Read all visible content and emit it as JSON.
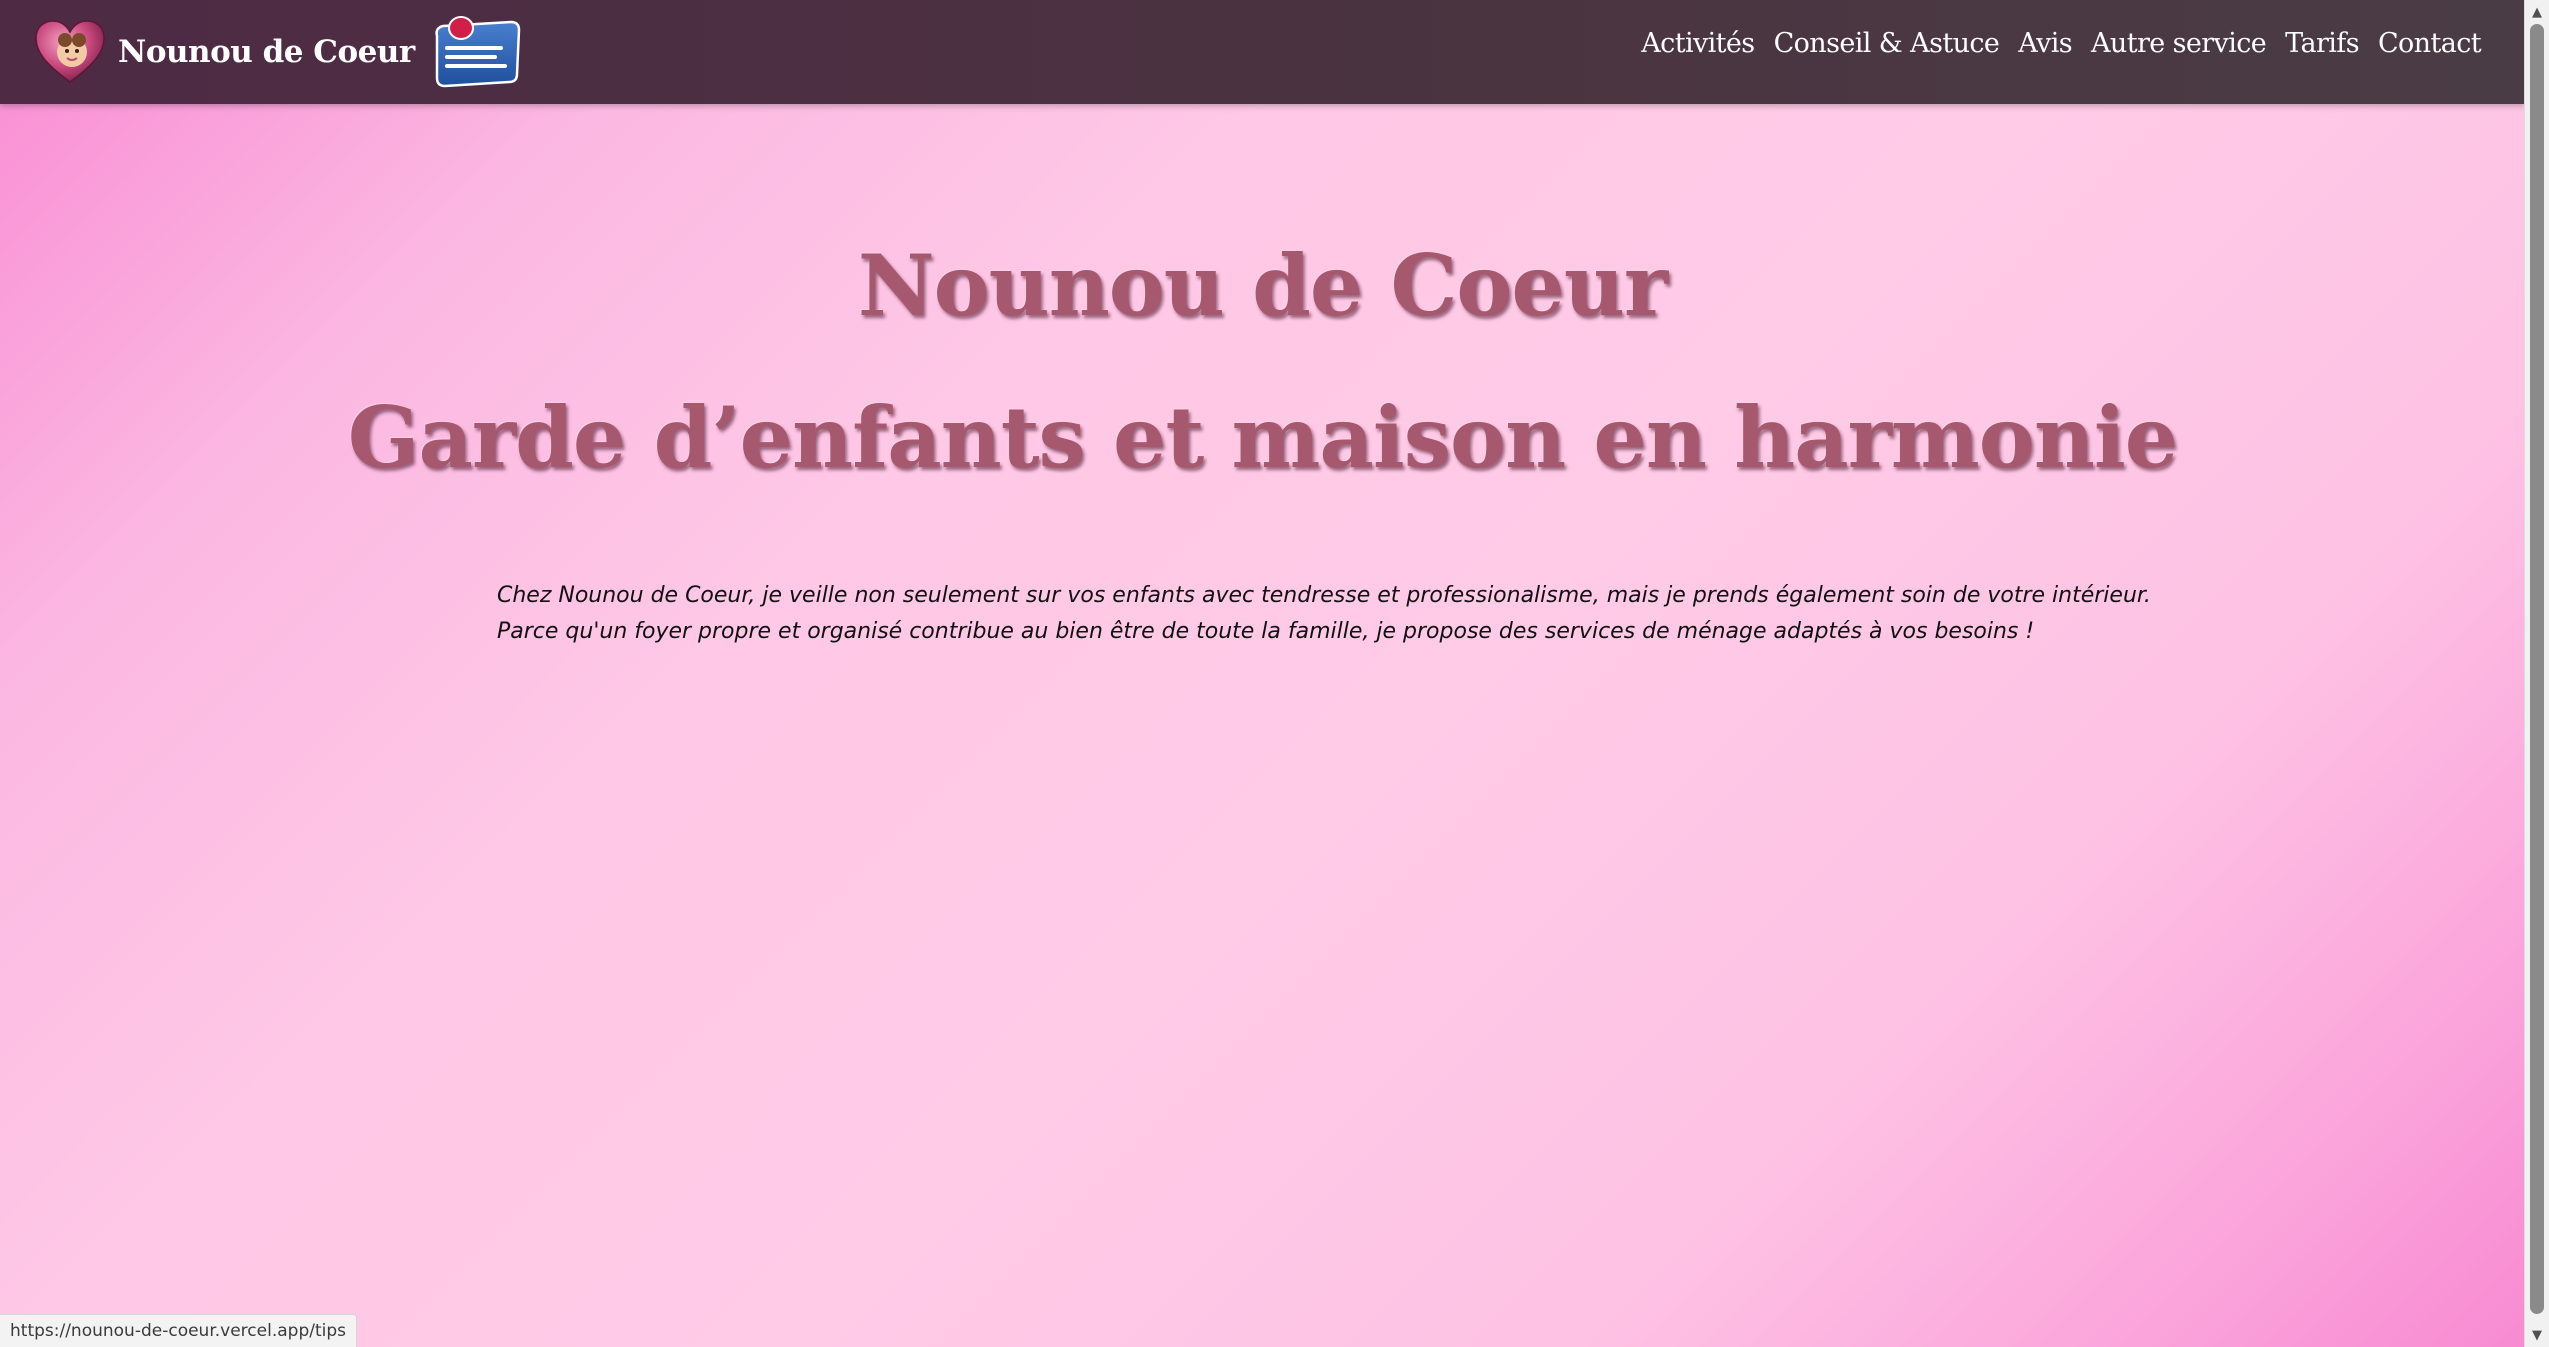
{
  "header": {
    "brand_name": "Nounou de Coeur",
    "nav": [
      {
        "label": "Activités"
      },
      {
        "label": "Conseil & Astuce"
      },
      {
        "label": "Avis"
      },
      {
        "label": "Autre service"
      },
      {
        "label": "Tarifs"
      },
      {
        "label": "Contact"
      }
    ],
    "icons": [
      "heart-baby-logo-icon",
      "services-a-la-personne-logo-icon"
    ]
  },
  "hero": {
    "title": "Nounou de Coeur",
    "subtitle": "Garde d’enfants et maison en harmonie",
    "intro_line_1": "Chez Nounou de Coeur, je veille non seulement sur vos enfants avec tendresse et professionalisme, mais je prends également soin de votre intérieur.",
    "intro_line_2": "Parce qu'un foyer propre et organisé contribue au bien être de toute la famille, je propose des services de ménage adaptés à vos besoins !"
  },
  "status_bar": {
    "hover_url": "https://nounou-de-coeur.vercel.app/tips"
  },
  "colors": {
    "navbar": "#4a3340",
    "title": "#a6586f",
    "background_pink": "#ffc8e6",
    "accent_pink": "#f889d2"
  }
}
